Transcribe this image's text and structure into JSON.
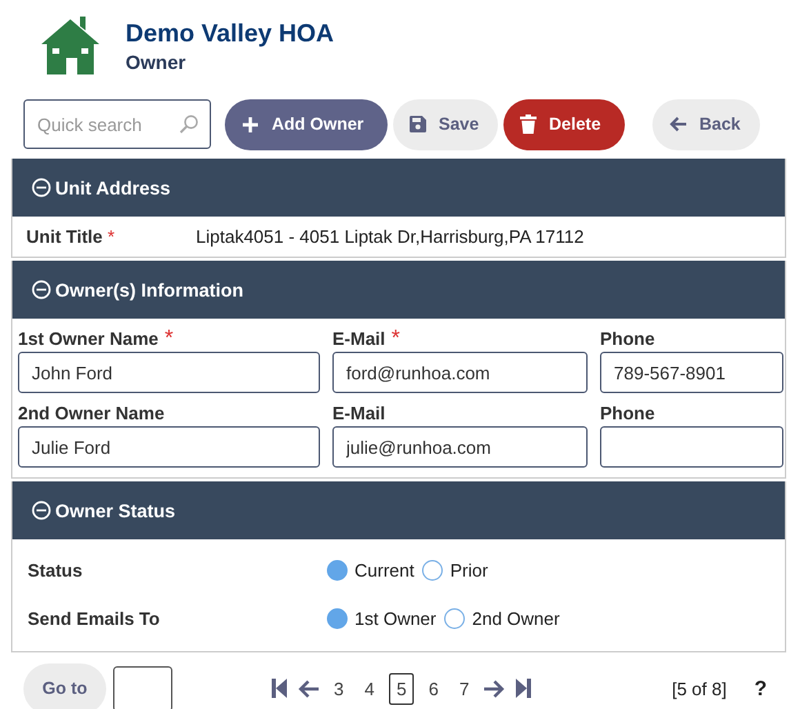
{
  "header": {
    "title": "Demo Valley HOA",
    "subtitle": "Owner"
  },
  "toolbar": {
    "search": {
      "placeholder": "Quick search"
    },
    "buttons": [
      {
        "label": "Add Owner",
        "kind": "add"
      },
      {
        "label": "Save",
        "kind": "save"
      },
      {
        "label": "Delete",
        "kind": "delete"
      },
      {
        "label": "Back",
        "kind": "back"
      }
    ]
  },
  "unit_address": {
    "title": "Unit Address",
    "expanded": true,
    "label": "Unit Title",
    "required_mark": "*",
    "value": "Liptak4051 - 4051 Liptak Dr,Harrisburg,PA 17112"
  },
  "owner_information": {
    "title": "Owner(s) Information",
    "expanded": true,
    "rows": [
      [
        {
          "label": "1st Owner Name",
          "required_mark": "*",
          "value": "John Ford"
        },
        {
          "label": "E-Mail",
          "required_mark": "*",
          "value": "ford@runhoa.com"
        },
        {
          "label": "Phone",
          "value": "789-567-8901"
        }
      ],
      [
        {
          "label": "2nd Owner Name",
          "value": "Julie Ford"
        },
        {
          "label": "E-Mail",
          "value": "julie@runhoa.com"
        },
        {
          "label": "Phone"
        }
      ]
    ]
  },
  "owner_status": {
    "title": "Owner Status",
    "expanded": true,
    "rows": [
      {
        "label": "Status",
        "options": [
          {
            "label": "Current",
            "selected": true
          },
          {
            "label": "Prior",
            "selected": false
          }
        ]
      },
      {
        "label": "Send Emails To",
        "options": [
          {
            "label": "1st Owner",
            "selected": true
          },
          {
            "label": "2nd Owner",
            "selected": false
          }
        ]
      }
    ]
  },
  "footer": {
    "goto": "Go to",
    "pages": [
      {
        "label": "3",
        "selected": false
      },
      {
        "label": "4",
        "selected": false
      },
      {
        "label": "5",
        "selected": true
      },
      {
        "label": "6",
        "selected": false
      },
      {
        "label": "7",
        "selected": false
      }
    ],
    "count": "[5 of 8]",
    "help": "?"
  }
}
